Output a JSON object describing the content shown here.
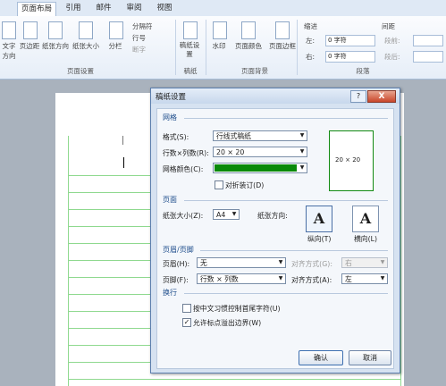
{
  "ribbon": {
    "tabs": [
      "页面布局",
      "引用",
      "邮件",
      "审阅",
      "视图"
    ],
    "buttons": {
      "text_direction": "文字方向",
      "margins": "页边距",
      "orientation": "纸张方向",
      "size": "纸张大小",
      "columns": "分栏",
      "breaks": "分隔符",
      "line_numbers": "行号",
      "hyphenation": "断字",
      "manuscript": "稿纸设置",
      "watermark": "水印",
      "page_color": "页面颜色",
      "page_border": "页面边框"
    },
    "groups": {
      "page_setup": "页面设置",
      "manuscript": "稿纸",
      "page_background": "页面背景",
      "paragraph": "段落"
    },
    "indent": {
      "title": "缩进",
      "left_label": "左:",
      "left_value": "0 字符",
      "right_label": "右:",
      "right_value": "0 字符"
    },
    "spacing": {
      "title": "间距",
      "before_label": "段前:",
      "after_label": "段后:"
    }
  },
  "dialog": {
    "title": "稿纸设置",
    "help": "?",
    "close": "X",
    "grid_section": "网格",
    "format_label": "格式(S):",
    "format_value": "行线式稿纸",
    "rowcol_label": "行数×列数(R):",
    "rowcol_value": "20 × 20",
    "color_label": "网格颜色(C):",
    "grid_color": "#0a8a0a",
    "fold_label": "对折装订(D)",
    "preview_text": "20 × 20",
    "page_section": "页面",
    "paper_size_label": "纸张大小(Z):",
    "paper_size_value": "A4",
    "orientation_label": "纸张方向:",
    "portrait_label": "纵向(T)",
    "landscape_label": "横向(L)",
    "header_section": "页眉/页脚",
    "header_label": "页眉(H):",
    "header_value": "无",
    "header_align_label": "对齐方式(G):",
    "header_align_value": "右",
    "footer_label": "页脚(F):",
    "footer_value": "行数 × 列数",
    "footer_align_label": "对齐方式(A):",
    "footer_align_value": "左",
    "wrap_section": "换行",
    "option1": "按中文习惯控制首尾字符(U)",
    "option2": "允许标点溢出边界(W)",
    "ok": "确认",
    "cancel": "取消"
  }
}
